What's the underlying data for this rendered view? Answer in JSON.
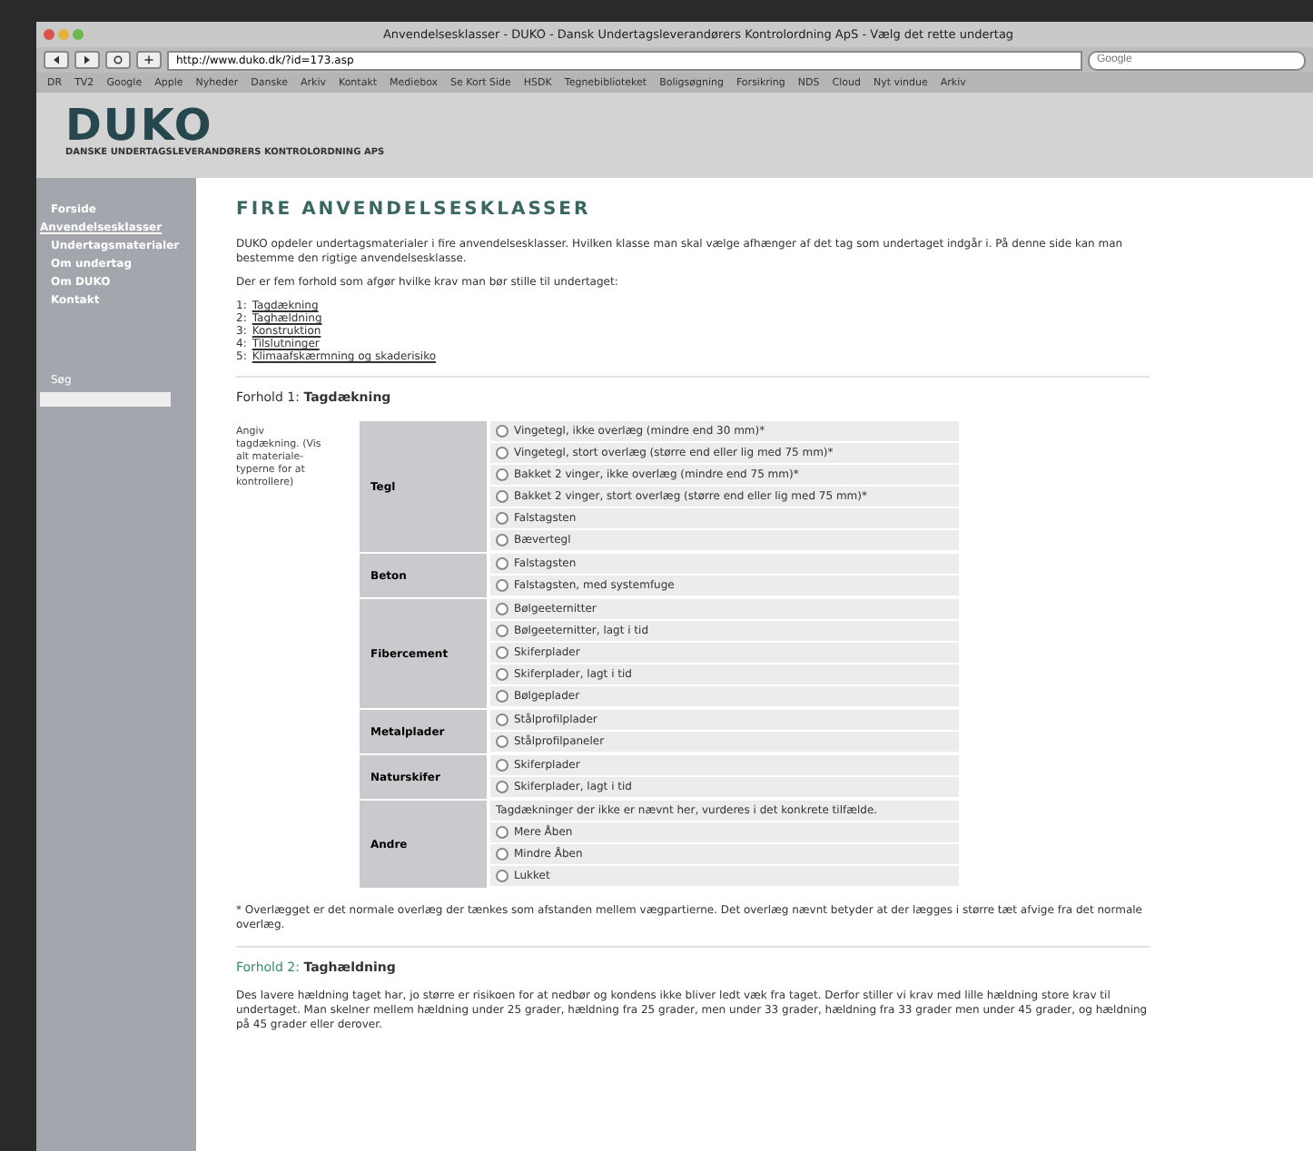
{
  "window": {
    "title": "Anvendelsesklasser - DUKO - Dansk Undertagsleverandørers Kontrolordning ApS - Vælg det rette undertag",
    "url": "http://www.duko.dk/?id=173.asp",
    "search_placeholder": "Google"
  },
  "bookmarks": [
    "DR",
    "TV2",
    "Google",
    "Apple",
    "Nyheder",
    "Danske",
    "Arkiv",
    "Kontakt",
    "Mediebox",
    "Se Kort Side",
    "HSDK",
    "Tegnebiblioteket",
    "Boligsøgning",
    "Forsikring",
    "NDS",
    "Cloud",
    "Nyt vindue",
    "Arkiv"
  ],
  "logo": {
    "name": "DUKO",
    "subtitle": "DANSKE UNDERTAGSLEVERANDØRERS KONTROLORDNING APS"
  },
  "sidebar": {
    "items": [
      {
        "label": "Forside",
        "selected": false
      },
      {
        "label": "Anvendelsesklasser",
        "selected": true
      },
      {
        "label": "Undertagsmaterialer",
        "selected": false
      },
      {
        "label": "Om undertag",
        "selected": false
      },
      {
        "label": "Om DUKO",
        "selected": false
      },
      {
        "label": "Kontakt",
        "selected": false
      }
    ],
    "search_label": "Søg"
  },
  "heading": "FIRE ANVENDELSESKLASSER",
  "intro": "DUKO opdeler undertagsmaterialer i fire anvendelsesklasser. Hvilken klasse man skal vælge afhænger af det tag som undertaget indgår i. På denne side kan man bestemme den rigtige anvendelsesklasse.",
  "factors_intro": "Der er fem forhold som afgør hvilke krav man bør stille til undertaget:",
  "factors": [
    {
      "number": "1:",
      "label": "Tagdækning"
    },
    {
      "number": "2:",
      "label": "Taghældning"
    },
    {
      "number": "3:",
      "label": "Konstruktion"
    },
    {
      "number": "4:",
      "label": "Tilslutninger"
    },
    {
      "number": "5:",
      "label": "Klimaafskærmning og skaderisiko"
    }
  ],
  "section1": {
    "prefix": "Forhold 1:",
    "title": "Tagdækning",
    "note": "Angiv tagdækning. (Vis alt materiale-typerne for at kontrollere)",
    "groups": [
      {
        "name": "Tegl",
        "options": [
          {
            "label": "Vingetegl, ikke overlæg (mindre end 30 mm)*",
            "selected": false
          },
          {
            "label": "Vingetegl, stort overlæg (større end eller lig med 75 mm)*",
            "selected": false
          },
          {
            "label": "Bakket 2 vinger, ikke overlæg (mindre end 75 mm)*",
            "selected": false
          },
          {
            "label": "Bakket 2 vinger, stort overlæg (større end eller lig med 75 mm)*",
            "selected": false
          },
          {
            "label": "Falstagsten",
            "selected": false
          },
          {
            "label": "Bævertegl",
            "selected": false
          }
        ]
      },
      {
        "name": "Beton",
        "options": [
          {
            "label": "Falstagsten",
            "selected": false
          },
          {
            "label": "Falstagsten, med systemfuge",
            "selected": false
          }
        ]
      },
      {
        "name": "Fibercement",
        "options": [
          {
            "label": "Bølgeeternitter",
            "selected": false
          },
          {
            "label": "Bølgeeternitter, lagt i tid",
            "selected": false
          },
          {
            "label": "Skiferplader",
            "selected": false
          },
          {
            "label": "Skiferplader, lagt i tid",
            "selected": false
          },
          {
            "label": "Bølgeplader",
            "selected": false
          }
        ]
      },
      {
        "name": "Metalplader",
        "options": [
          {
            "label": "Stålprofilplader",
            "selected": false
          },
          {
            "label": "Stålprofilpaneler",
            "selected": false
          }
        ]
      },
      {
        "name": "Naturskifer",
        "options": [
          {
            "label": "Skiferplader",
            "selected": false
          },
          {
            "label": "Skiferplader, lagt i tid",
            "selected": false
          }
        ]
      },
      {
        "name": "Andre",
        "text": "Tagdækninger der ikke er nævnt her, vurderes i det konkrete tilfælde.",
        "options": [
          {
            "label": "Mere Åben",
            "selected": false
          },
          {
            "label": "Mindre Åben",
            "selected": false
          },
          {
            "label": "Lukket",
            "selected": false
          }
        ]
      }
    ],
    "footnote": "* Overlægget er det normale overlæg der tænkes som afstanden mellem vægpartierne. Det overlæg nævnt betyder at der lægges i større tæt afvige fra det normale overlæg."
  },
  "section2": {
    "prefix": "Forhold 2:",
    "title": "Taghældning",
    "text": "Des lavere hældning taget har, jo større er risikoen for at nedbør og kondens ikke bliver ledt væk fra taget. Derfor stiller vi krav med lille hældning store krav til undertaget. Man skelner mellem hældning under 25 grader, hældning fra 25 grader, men under 33 grader, hældning fra 33 grader men under 45 grader, og hældning på 45 grader eller derover."
  }
}
